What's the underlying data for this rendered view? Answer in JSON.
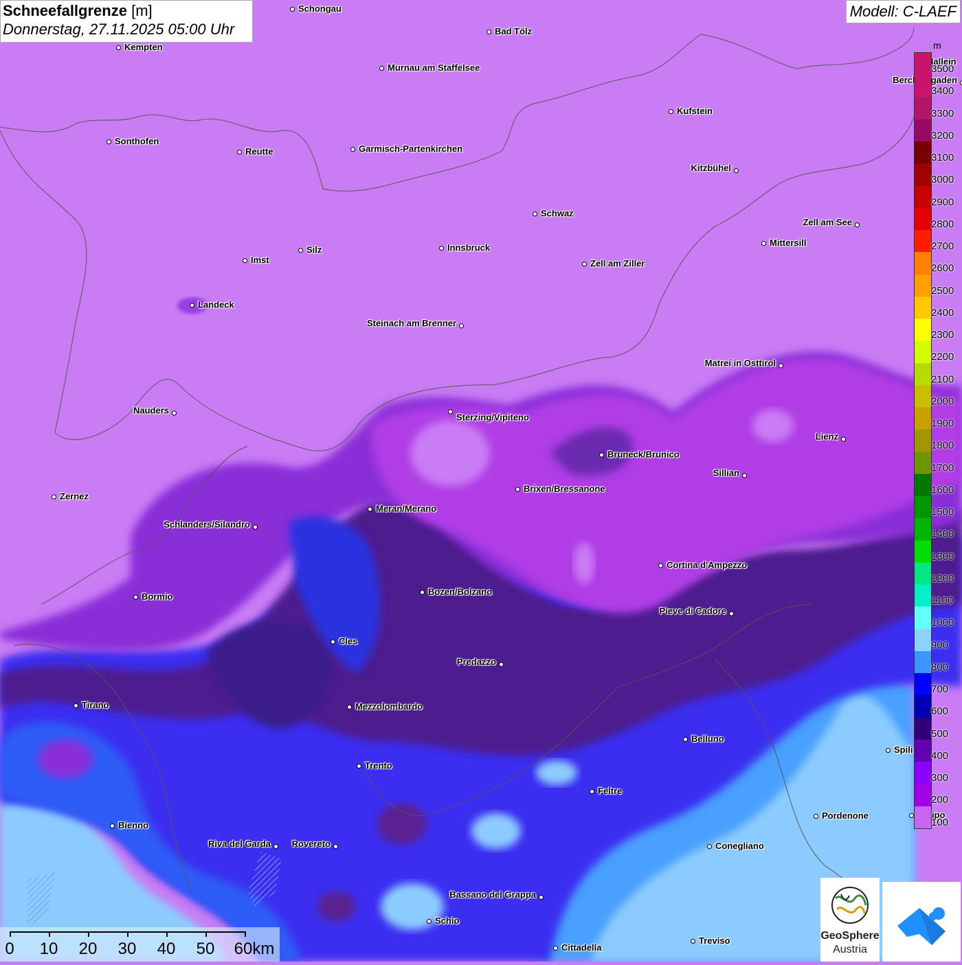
{
  "title": {
    "main": "Schneefallgrenze",
    "unit": "[m]",
    "datetime": "Donnerstag, 27.11.2025 05:00 Uhr"
  },
  "model": "Modell: C-LAEF",
  "legend": {
    "unit": "m",
    "levels": [
      {
        "label": "3500",
        "color": "#c8146e"
      },
      {
        "label": "3400",
        "color": "#c8146e"
      },
      {
        "label": "3300",
        "color": "#b4146a"
      },
      {
        "label": "3200",
        "color": "#960a64"
      },
      {
        "label": "3100",
        "color": "#780000"
      },
      {
        "label": "3000",
        "color": "#a00000"
      },
      {
        "label": "2900",
        "color": "#c80000"
      },
      {
        "label": "2800",
        "color": "#e60000"
      },
      {
        "label": "2700",
        "color": "#ff1e00"
      },
      {
        "label": "2600",
        "color": "#ff8200"
      },
      {
        "label": "2500",
        "color": "#ffa000"
      },
      {
        "label": "2400",
        "color": "#ffc800"
      },
      {
        "label": "2300",
        "color": "#ffff00"
      },
      {
        "label": "2200",
        "color": "#d2ff00"
      },
      {
        "label": "2100",
        "color": "#b4dc00"
      },
      {
        "label": "2000",
        "color": "#c8be00"
      },
      {
        "label": "1900",
        "color": "#c8a000"
      },
      {
        "label": "1800",
        "color": "#a09600"
      },
      {
        "label": "1700",
        "color": "#6e9600"
      },
      {
        "label": "1600",
        "color": "#007800"
      },
      {
        "label": "1500",
        "color": "#009600"
      },
      {
        "label": "1400",
        "color": "#00b400"
      },
      {
        "label": "1300",
        "color": "#00dc00"
      },
      {
        "label": "1200",
        "color": "#00e682"
      },
      {
        "label": "1100",
        "color": "#00f0c8"
      },
      {
        "label": "1000",
        "color": "#64ffff"
      },
      {
        "label": "900",
        "color": "#8cd2ff"
      },
      {
        "label": "800",
        "color": "#3c96ff"
      },
      {
        "label": "700",
        "color": "#0000ff"
      },
      {
        "label": "600",
        "color": "#0000b4"
      },
      {
        "label": "500",
        "color": "#320078"
      },
      {
        "label": "400",
        "color": "#6400b4"
      },
      {
        "label": "300",
        "color": "#8c00ff"
      },
      {
        "label": "200",
        "color": "#a000e6"
      },
      {
        "label": "100",
        "color": "#c864f0"
      }
    ]
  },
  "cities": [
    {
      "name": "Schongau"
    },
    {
      "name": "Kempten"
    },
    {
      "name": "Bad Tölz"
    },
    {
      "name": "Murnau am Staffelsee"
    },
    {
      "name": "Berchtesgaden"
    },
    {
      "name": "Kufstein"
    },
    {
      "name": "Sonthofen"
    },
    {
      "name": "Reutte"
    },
    {
      "name": "Garmisch-Partenkirchen"
    },
    {
      "name": "Kitzbühel"
    },
    {
      "name": "Schwaz"
    },
    {
      "name": "Zell am See"
    },
    {
      "name": "Mittersill"
    },
    {
      "name": "Innsbruck"
    },
    {
      "name": "Imst"
    },
    {
      "name": "Silz"
    },
    {
      "name": "Zell am Ziller"
    },
    {
      "name": "Landeck"
    },
    {
      "name": "Steinach am Brenner"
    },
    {
      "name": "Matrei in Osttirol"
    },
    {
      "name": "Nauders"
    },
    {
      "name": "Sterzing/Vipiteno"
    },
    {
      "name": "Lienz"
    },
    {
      "name": "Bruneck/Brunico"
    },
    {
      "name": "Sillian"
    },
    {
      "name": "Zernez"
    },
    {
      "name": "Brixen/Bressanone"
    },
    {
      "name": "Meran/Merano"
    },
    {
      "name": "Schlanders/Silandro"
    },
    {
      "name": "Cortina d'Ampezzo"
    },
    {
      "name": "Bozen/Bolzano"
    },
    {
      "name": "Bormio"
    },
    {
      "name": "Pieve di Cadore"
    },
    {
      "name": "Cles"
    },
    {
      "name": "Predazzo"
    },
    {
      "name": "Tirano"
    },
    {
      "name": "Mezzolombardo"
    },
    {
      "name": "Belluno"
    },
    {
      "name": "Spili"
    },
    {
      "name": "Trento"
    },
    {
      "name": "Feltre"
    },
    {
      "name": "Pordenone"
    },
    {
      "name": "Bienno"
    },
    {
      "name": "Riva del Garda"
    },
    {
      "name": "Rovereto"
    },
    {
      "name": "Conegliano"
    },
    {
      "name": "Bassano del Grappa"
    },
    {
      "name": "Schio"
    },
    {
      "name": "Treviso"
    },
    {
      "name": "Cittadella"
    },
    {
      "name": "droipo"
    },
    {
      "name": "Hallein"
    }
  ],
  "scalebar": {
    "labels": [
      "0",
      "10",
      "20",
      "30",
      "40",
      "50",
      "60km"
    ]
  },
  "logos": {
    "geosphere_line1": "GeoSphere",
    "geosphere_line2": "Austria"
  }
}
